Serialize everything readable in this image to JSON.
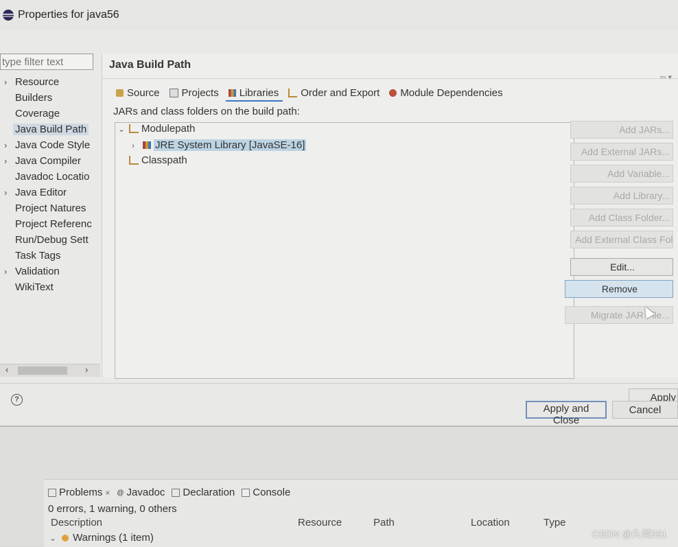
{
  "window": {
    "title": "Properties for java56"
  },
  "filter": {
    "placeholder": "type filter text"
  },
  "nav": {
    "items": [
      {
        "label": "Resource",
        "expandable": true
      },
      {
        "label": "Builders",
        "expandable": false
      },
      {
        "label": "Coverage",
        "expandable": false
      },
      {
        "label": "Java Build Path",
        "expandable": false,
        "selected": true
      },
      {
        "label": "Java Code Style",
        "expandable": true
      },
      {
        "label": "Java Compiler",
        "expandable": true
      },
      {
        "label": "Javadoc Locatio",
        "expandable": false
      },
      {
        "label": "Java Editor",
        "expandable": true
      },
      {
        "label": "Project Natures",
        "expandable": false
      },
      {
        "label": "Project Referenc",
        "expandable": false
      },
      {
        "label": "Run/Debug Sett",
        "expandable": false
      },
      {
        "label": "Task Tags",
        "expandable": false
      },
      {
        "label": "Validation",
        "expandable": true
      },
      {
        "label": "WikiText",
        "expandable": false
      }
    ]
  },
  "page": {
    "heading": "Java Build Path",
    "tabs": [
      {
        "label": "Source",
        "icon": "source-folder-icon"
      },
      {
        "label": "Projects",
        "icon": "projects-icon"
      },
      {
        "label": "Libraries",
        "icon": "libraries-icon",
        "active": true
      },
      {
        "label": "Order and Export",
        "icon": "order-export-icon"
      },
      {
        "label": "Module Dependencies",
        "icon": "module-dependencies-icon"
      }
    ],
    "description": "JARs and class folders on the build path:",
    "tree": {
      "modulepath": "Modulepath",
      "jre": "JRE System Library [JavaSE-16]",
      "classpath": "Classpath"
    },
    "buttons": {
      "add_jars": "Add JARs...",
      "add_external_jars": "Add External JARs...",
      "add_variable": "Add Variable...",
      "add_library": "Add Library...",
      "add_class_folder": "Add Class Folder...",
      "add_external_class_folder": "Add External Class Folder...",
      "edit": "Edit...",
      "remove": "Remove",
      "migrate_jar": "Migrate JAR File..."
    },
    "apply": "Apply"
  },
  "footer": {
    "help": "?",
    "apply_and_close": "Apply and Close",
    "cancel": "Cancel"
  },
  "views": {
    "tabs": [
      "Problems",
      "Javadoc",
      "Declaration",
      "Console"
    ],
    "summary": "0 errors, 1 warning, 0 others",
    "columns": [
      "Description",
      "Resource",
      "Path",
      "Location",
      "Type"
    ],
    "warnings_row": "Warnings (1 item)"
  },
  "watermark": "CSDN @久倾331",
  "colors": {
    "selection": "#bcd3e3",
    "accent": "#3b78c4",
    "warning": "#e0a13b"
  }
}
